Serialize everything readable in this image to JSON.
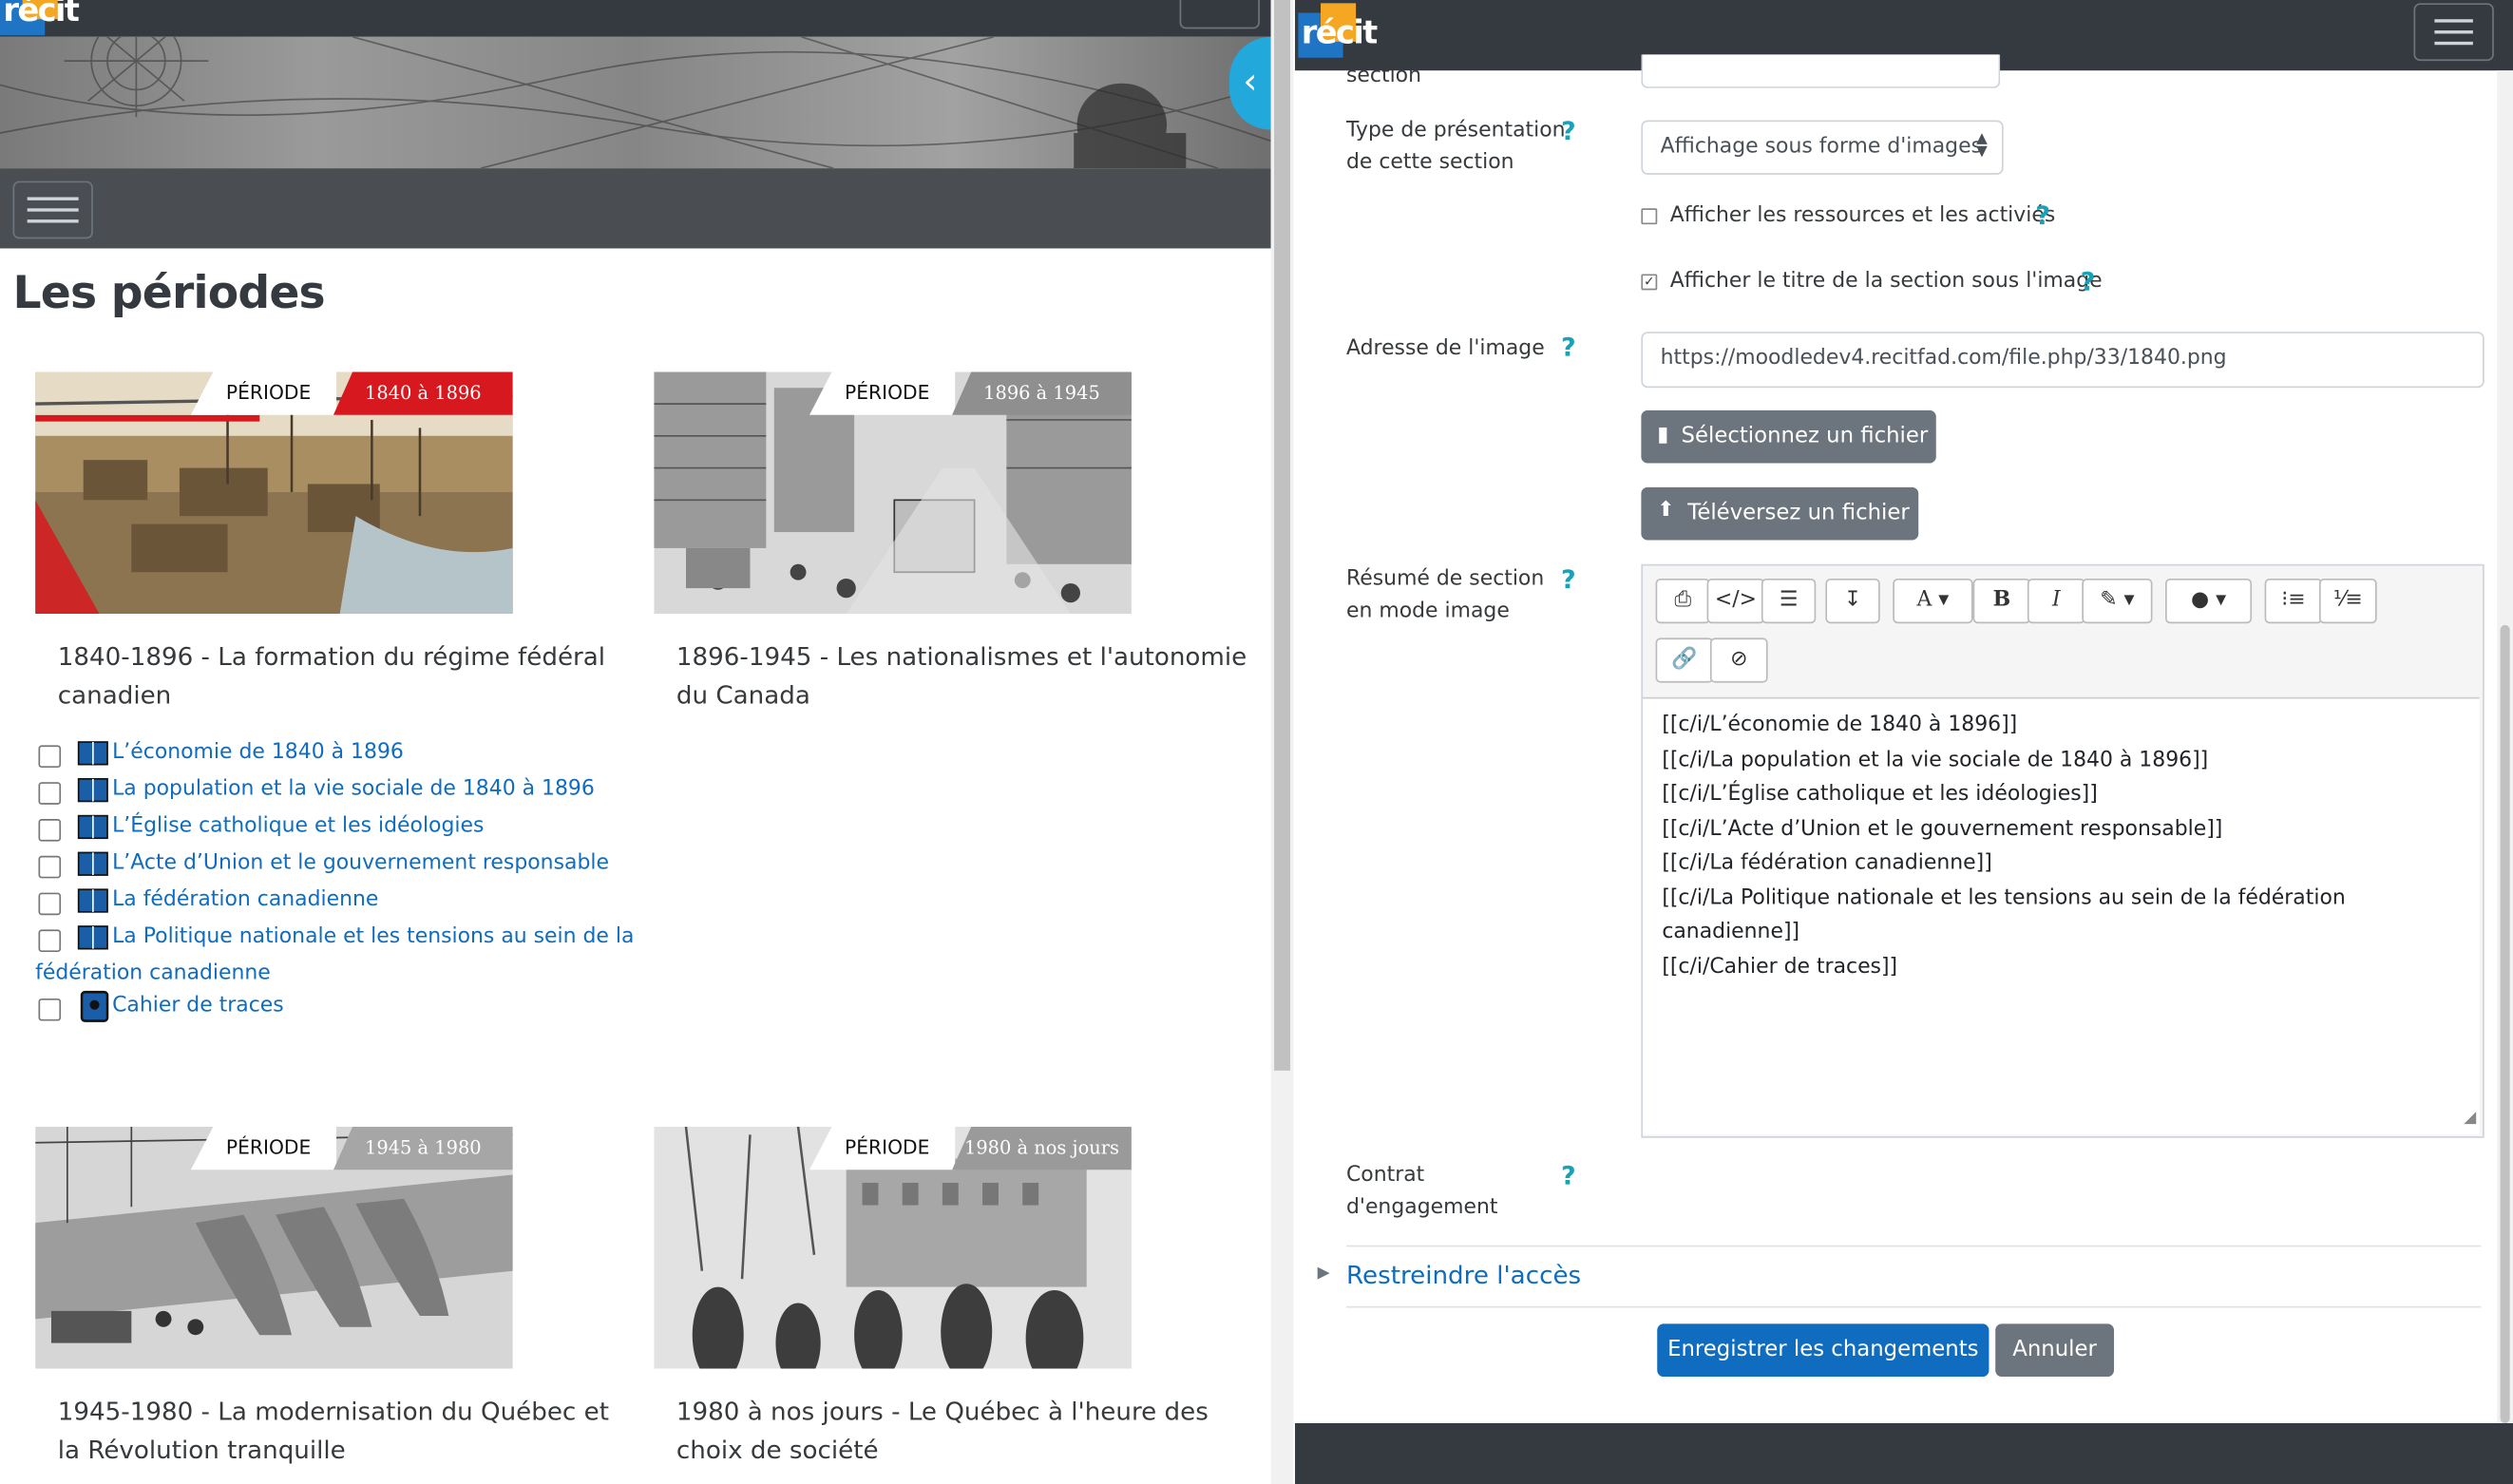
{
  "left": {
    "logo_text": "récit",
    "title": "Les périodes",
    "cards": [
      {
        "band_label": "PÉRIODE",
        "range": "1840 à 1896",
        "range_color": "#d7191f",
        "title_line1": "1840-1896 - La formation du régime fédéral",
        "title_line2": "canadien"
      },
      {
        "band_label": "PÉRIODE",
        "range": "1896 à 1945",
        "range_color": "#8f8f8f",
        "title_line1": "1896-1945 - Les nationalismes et l'autonomie",
        "title_line2": "du Canada"
      },
      {
        "band_label": "PÉRIODE",
        "range": "1945 à 1980",
        "range_color": "#a6a6a6",
        "title_line1": "1945-1980 - La modernisation du Québec et",
        "title_line2": "la Révolution tranquille"
      },
      {
        "band_label": "PÉRIODE",
        "range": "1980 à nos jours",
        "range_color": "#9a9a9a",
        "title_line1": "1980 à nos jours - Le Québec à l'heure des",
        "title_line2": "choix de société"
      }
    ],
    "activities": [
      {
        "label": "L’économie de 1840 à 1896",
        "icon": "book-icon"
      },
      {
        "label": "La population et la vie sociale de 1840 à 1896",
        "icon": "book-icon"
      },
      {
        "label": "L’Église catholique et les idéologies",
        "icon": "book-icon"
      },
      {
        "label": "L’Acte d’Union et le gouvernement responsable",
        "icon": "book-icon"
      },
      {
        "label": "La fédération canadienne",
        "icon": "book-icon"
      },
      {
        "label_line1": "La Politique nationale et les tensions au sein de la",
        "label_line2": "fédération canadienne",
        "icon": "book-icon"
      },
      {
        "label": "Cahier de traces",
        "icon": "journal-icon"
      }
    ]
  },
  "right": {
    "logo_text": "récit",
    "section_label_partial": "section",
    "presentation_label_line1": "Type de présentation",
    "presentation_label_line2": "de cette section",
    "presentation_value": "Affichage sous forme d'images",
    "show_resources_label": "Afficher les ressources et les activiés",
    "show_resources_checked": false,
    "show_title_label": "Afficher le titre de la section sous l'image",
    "show_title_checked": true,
    "image_address_label": "Adresse de l'image",
    "image_address_value": "https://moodledev4.recitfad.com/file.php/33/1840.png",
    "select_file_button": "Sélectionnez un fichier",
    "upload_file_button": "Téléversez un fichier",
    "summary_label_line1": "Résumé de section",
    "summary_label_line2": "en mode image",
    "editor_lines": [
      "[[c/i/L’économie de 1840 à 1896]]",
      "[[c/i/La population et la vie sociale de 1840 à 1896]]",
      "[[c/i/L’Église catholique et les idéologies]]",
      "[[c/i/L’Acte d’Union et le gouvernement responsable]]",
      "[[c/i/La fédération canadienne]]",
      "[[c/i/La Politique nationale et les tensions au sein de la fédération",
      "canadienne]]",
      "[[c/i/Cahier de traces]]"
    ],
    "contract_label_line1": "Contrat",
    "contract_label_line2": "d'engagement",
    "restrict_access_label": "Restreindre l'accès",
    "save_button": "Enregistrer les changements",
    "cancel_button": "Annuler",
    "help_symbol": "?",
    "accent_color": "#0f6cbf",
    "help_color": "#17a2b8"
  }
}
